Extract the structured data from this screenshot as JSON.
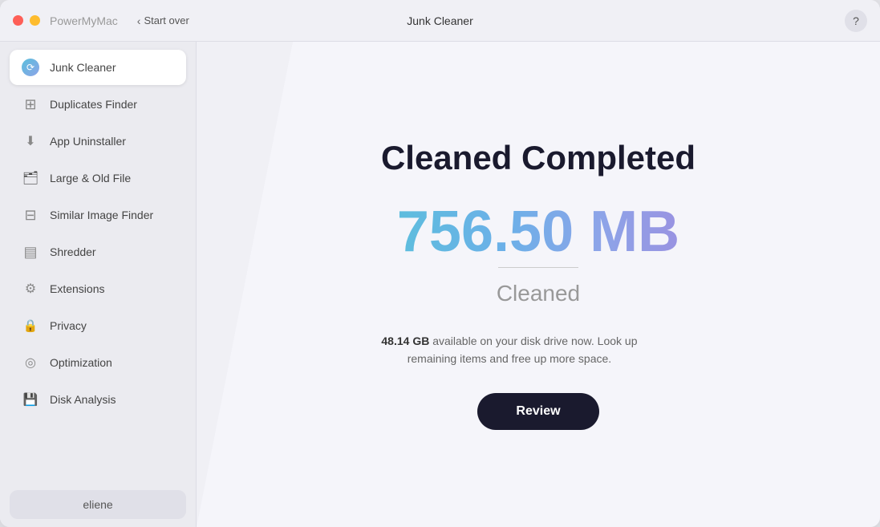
{
  "window": {
    "title": "Junk Cleaner",
    "app_name": "PowerMyMac"
  },
  "title_bar": {
    "start_over_label": "Start over",
    "help_label": "?"
  },
  "sidebar": {
    "items": [
      {
        "id": "junk-cleaner",
        "label": "Junk Cleaner",
        "active": true
      },
      {
        "id": "duplicates-finder",
        "label": "Duplicates Finder",
        "active": false
      },
      {
        "id": "app-uninstaller",
        "label": "App Uninstaller",
        "active": false
      },
      {
        "id": "large-old-file",
        "label": "Large & Old File",
        "active": false
      },
      {
        "id": "similar-image-finder",
        "label": "Similar Image Finder",
        "active": false
      },
      {
        "id": "shredder",
        "label": "Shredder",
        "active": false
      },
      {
        "id": "extensions",
        "label": "Extensions",
        "active": false
      },
      {
        "id": "privacy",
        "label": "Privacy",
        "active": false
      },
      {
        "id": "optimization",
        "label": "Optimization",
        "active": false
      },
      {
        "id": "disk-analysis",
        "label": "Disk Analysis",
        "active": false
      }
    ],
    "user": {
      "label": "eliene"
    }
  },
  "main": {
    "cleaned_title": "Cleaned Completed",
    "cleaned_amount": "756.50 MB",
    "cleaned_label": "Cleaned",
    "disk_available": "48.14 GB",
    "disk_message": " available on your disk drive now. Look up remaining items and free up more space.",
    "review_button": "Review"
  },
  "colors": {
    "accent_gradient_start": "#5bbfdc",
    "accent_gradient_end": "#9b8fe0",
    "dark_button": "#1a1a2e"
  }
}
